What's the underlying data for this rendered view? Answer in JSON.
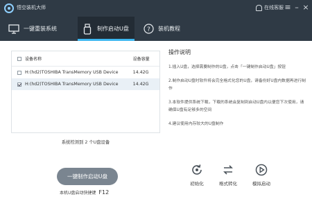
{
  "titlebar": {
    "app_title": "悟空装机大师",
    "help_label": "在线客服"
  },
  "tabs": [
    {
      "label": "一键重装系统"
    },
    {
      "label": "制作启动U盘"
    },
    {
      "label": "装机教程"
    }
  ],
  "device_list": {
    "columns": [
      "设备名称",
      "设备容量"
    ],
    "rows": [
      {
        "name": "H:(hd2)TOSHIBA TransMemory USB Device",
        "capacity": "14.42G",
        "checked": false
      },
      {
        "name": "H:(hd2)TOSHIBA TransMemory USB Device",
        "capacity": "14.42G",
        "checked": true
      }
    ],
    "detected_text": "系统检测到 2 个U盘设备"
  },
  "instructions": {
    "title": "操作说明",
    "steps": [
      "1.插入U盘，选择需要制作的U盘，点击「一键制作启动U盘」按钮",
      "2.制作启动U盘时软件将会完全格式化您的U盘，请备份好U盘内数据再进行制作",
      "3.本软件提供系统下载，下载的系统会复制到启动U盘内以便您下次使用，请确保U盘有足够多的空间",
      "4.建议使用内存较大的U盘制作"
    ]
  },
  "make_button_label": "一键制作启动U盘",
  "hotkey": {
    "label": "本机U盘启动快捷键",
    "key": "F12"
  },
  "actions": [
    {
      "label": "初始化",
      "icon": "reset-icon"
    },
    {
      "label": "格式转化",
      "icon": "convert-icon"
    },
    {
      "label": "模拟启动",
      "icon": "play-icon"
    }
  ],
  "colors": {
    "header_bg": "#2f3a45",
    "active_tab_bg": "#232c35",
    "accent": "#3db7f0",
    "button_bg": "#7a8590"
  }
}
